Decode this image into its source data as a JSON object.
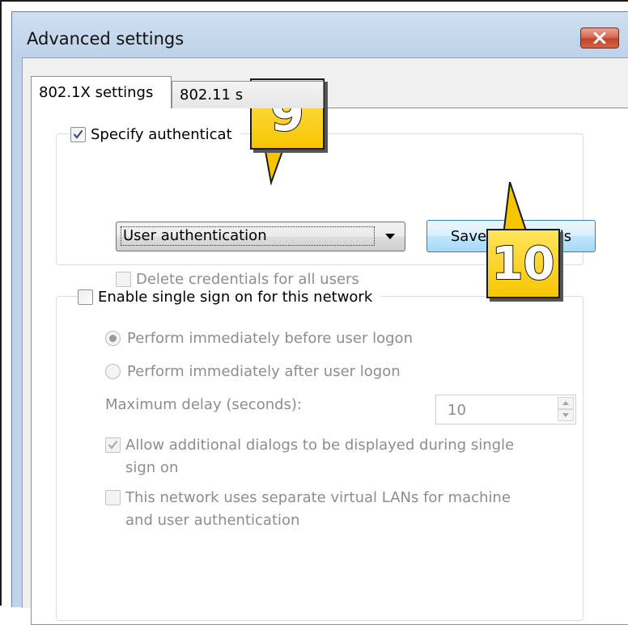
{
  "window": {
    "title": "Advanced settings",
    "close_icon": "close-x-icon",
    "accent_close": "#c8482f"
  },
  "tabs": [
    {
      "label": "802.1X settings",
      "active": true
    },
    {
      "label": "802.11 s",
      "active": false
    }
  ],
  "auth_group": {
    "checkbox_label": "Specify authenticat",
    "checked": true,
    "dropdown_value": "User authentication",
    "save_button": "Save credentials",
    "delete_label": "Delete credentials for all users"
  },
  "sso_group": {
    "checkbox_label": "Enable single sign on for this network",
    "checked": false,
    "radio_before": "Perform immediately before user logon",
    "radio_after": "Perform immediately after user logon",
    "delay_label": "Maximum delay (seconds):",
    "delay_value": "10",
    "allow_dialogs_line1": "Allow additional dialogs to be displayed during single",
    "allow_dialogs_line2": "sign on",
    "vlan_line1": "This network uses separate virtual LANs for machine",
    "vlan_line2": "and user authentication"
  },
  "callouts": [
    {
      "number": "9"
    },
    {
      "number": "10"
    }
  ]
}
